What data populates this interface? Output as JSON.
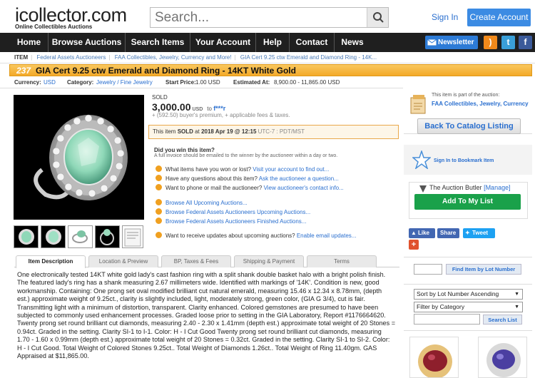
{
  "header": {
    "logo_main": "icollector.com",
    "logo_sub": "Online Collectibles Auctions",
    "search_placeholder": "Search...",
    "signin": "Sign In",
    "create_account": "Create Account"
  },
  "nav": {
    "items": [
      "Home",
      "Browse Auctions",
      "Search Items",
      "Your Account",
      "Help",
      "Contact",
      "News"
    ],
    "newsletter": "Newsletter"
  },
  "breadcrumb": {
    "label": "ITEM",
    "items": [
      "Federal Assets Auctioneers",
      "FAA Collectibles, Jewelry, Currency and More!",
      "GIA Cert 9.25 ctw Emerald and Diamond Ring - 14K..."
    ]
  },
  "lot": {
    "number": "237",
    "title": "GIA Cert 9.25 ctw Emerald and Diamond Ring - 14KT White Gold"
  },
  "meta": {
    "currency_label": "Currency:",
    "currency": "USD",
    "category_label": "Category:",
    "category": "Jewelry / Fine Jewelry",
    "start_label": "Start Price:",
    "start": "1.00 USD",
    "estimate_label": "Estimated At:",
    "estimate": "8,900.00 - 11,865.00 USD"
  },
  "sale": {
    "sold_label": "SOLD",
    "price": "3,000.00",
    "currency": "USD",
    "to": "to",
    "buyer": "f***r",
    "premium": "+ (592.50) buyer's premium, + applicable fees & taxes.",
    "sold_info_pre": "This item",
    "sold_word": "SOLD",
    "sold_at": "at",
    "sold_date": "2018 Apr 19 @ 12:15",
    "sold_tz": "UTC-7 : PDT/MST"
  },
  "win": {
    "title": "Did you win this item?",
    "sub": "A full invoice should be emailed to the winner by the auctioneer within a day or two."
  },
  "links": [
    {
      "text": "What items have you won or lost?",
      "link": "Visit your account to find out..."
    },
    {
      "text": "Have any questions about this item?",
      "link": "Ask the auctioneer a question..."
    },
    {
      "text": "Want to phone or mail the auctioneer?",
      "link": "View auctioneer's contact info..."
    },
    {
      "text": "",
      "link": "Browse All Upcoming Auctions..."
    },
    {
      "text": "",
      "link": "Browse Federal Assets Auctioneers Upcoming Auctions..."
    },
    {
      "text": "",
      "link": "Browse Federal Assets Auctioneers Finished Auctions..."
    },
    {
      "text": "Want to receive updates about upcoming auctions?",
      "link": "Enable email updates..."
    }
  ],
  "tabs": [
    "Item Description",
    "Location & Preview",
    "BP, Taxes & Fees",
    "Shipping & Payment",
    "Terms"
  ],
  "description": "One electronically tested 14KT white gold lady's cast fashion ring with a split shank double basket halo with a bright polish finish. The featured lady's ring has a shank measuring 2.67 millimeters wide. Identified with markings of '14K'. Condition is new, good workmanship. Containing: One prong set oval modified brilliant cut natural emerald, measuring 15.46 x 12.34 x 8.78mm, (depth est.) approximate weight of 9.25ct., clarity is slightly included, light, moderately strong, green color, (GIA G 3/4), cut is fair. Transmitting light with a minimum of distortion, transparent. Clarity enhanced. Colored gemstones are presumed to have been subjected to commonly used enhancement processes. Graded loose prior to setting in the GIA Laboratory, Report #1176664620. Twenty prong set round brilliant cut diamonds, measuring 2.40 - 2.30 x 1.41mm (depth est.) approximate total weight of 20 Stones = 0.94ct. Graded in the setting. Clarity SI-1 to I-1. Color: H - I Cut Good Twenty prong set round brilliant cut diamonds, measuring 1.70 - 1.60 x 0.99mm (depth est.) approximate total weight of 20 Stones = 0.32ct. Graded in the setting. Clarity SI-1 to SI-2. Color: H - I Cut Good. Total Weight of Colored Stones 9.25ct.. Total Weight of Diamonds 1.26ct.. Total Weight of Ring 11.40gm. GAS Appraised at $11,865.00.",
  "sidebar": {
    "part_of": "This item is part of the auction:",
    "auction_link": "FAA Collectibles, Jewelry, Currency",
    "back": "Back To Catalog Listing",
    "bookmark": "Sign In to Bookmark Item",
    "butler": "The Auction Butler",
    "manage": "[Manage]",
    "add": "Add To My List",
    "like": "Like",
    "share": "Share",
    "tweet": "Tweet",
    "find_lot": "Find Item by Lot Number",
    "sort": "Sort by Lot Number Ascending",
    "filter": "Filter by Category",
    "search_list": "Search List"
  },
  "colors": {
    "accent": "#3c8be3",
    "title_bar": "#f3a928",
    "green": "#1aa14a",
    "nav": "#1f1f1f"
  }
}
